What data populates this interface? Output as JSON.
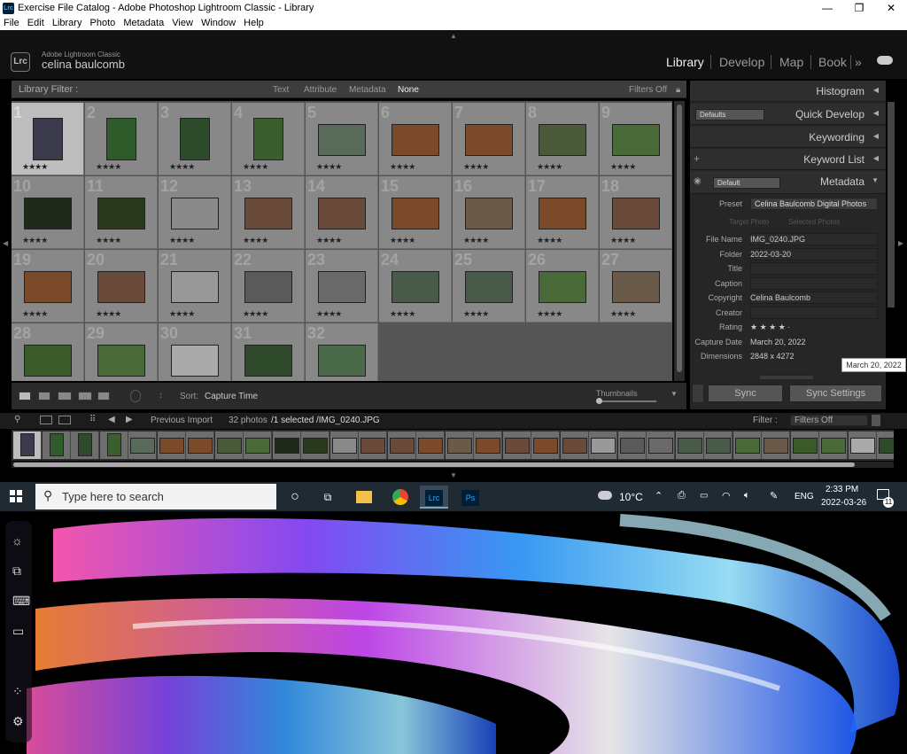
{
  "window": {
    "title": "Exercise File Catalog - Adobe Photoshop Lightroom Classic - Library",
    "app_icon": "Lrc"
  },
  "menu": [
    "File",
    "Edit",
    "Library",
    "Photo",
    "Metadata",
    "View",
    "Window",
    "Help"
  ],
  "identity": {
    "logo": "Lrc",
    "product": "Adobe Lightroom Classic",
    "user": "celina baulcomb"
  },
  "modules": [
    "Library",
    "Develop",
    "Map",
    "Book"
  ],
  "module_more": "»",
  "library_filter": {
    "label": "Library Filter :",
    "options": [
      "Text",
      "Attribute",
      "Metadata",
      "None"
    ],
    "selected": "None",
    "status": "Filters Off"
  },
  "grid": {
    "rows": [
      [
        "1",
        "2",
        "3",
        "4",
        "5",
        "6",
        "7",
        "8",
        "9"
      ],
      [
        "10",
        "11",
        "12",
        "13",
        "14",
        "15",
        "16",
        "17",
        "18"
      ],
      [
        "19",
        "20",
        "21",
        "22",
        "23",
        "24",
        "25",
        "26",
        "27"
      ],
      [
        "28",
        "29",
        "30",
        "31",
        "32"
      ]
    ],
    "stars": "★★★★"
  },
  "toolbar": {
    "sort_label": "Sort:",
    "sort_value": "Capture Time",
    "thumbnails_label": "Thumbnails"
  },
  "right_panel": {
    "histogram": "Histogram",
    "quick_develop": "Quick Develop",
    "qd_preset": "Defaults",
    "keywording": "Keywording",
    "keyword_list": "Keyword List",
    "metadata": "Metadata",
    "md_preset": "Default",
    "preset_label": "Preset",
    "preset_value": "Celina Baulcomb Digital Photos",
    "target_tabs": [
      "Target Photo",
      "Selected Photos"
    ],
    "fields": [
      {
        "key": "File Name",
        "value": "IMG_0240.JPG"
      },
      {
        "key": "Folder",
        "value": "2022-03-20"
      },
      {
        "key": "Title",
        "value": ""
      },
      {
        "key": "Caption",
        "value": ""
      },
      {
        "key": "Copyright",
        "value": "Celina Baulcomb"
      },
      {
        "key": "Creator",
        "value": ""
      },
      {
        "key": "Rating",
        "value": "★ ★ ★ ★ ·"
      },
      {
        "key": "Capture Date",
        "value": "March 20, 2022"
      },
      {
        "key": "Dimensions",
        "value": "2848 x 4272"
      }
    ],
    "sync": "Sync",
    "sync_settings": "Sync Settings"
  },
  "tooltip": "March 20, 2022",
  "filmstrip": {
    "source": "Previous Import",
    "count": "32 photos",
    "selected": "/1 selected",
    "file": "/IMG_0240.JPG",
    "filter_label": "Filter :",
    "filter_value": "Filters Off"
  },
  "taskbar": {
    "search_placeholder": "Type here to search",
    "weather": "10°C",
    "lang": "ENG",
    "time": "2:33 PM",
    "date": "2022-03-26",
    "notifications": "11",
    "ps": "Ps",
    "lrc": "Lrc"
  },
  "colors": {
    "accent": "#31a8ff",
    "taskbar": "#1f2a33"
  }
}
